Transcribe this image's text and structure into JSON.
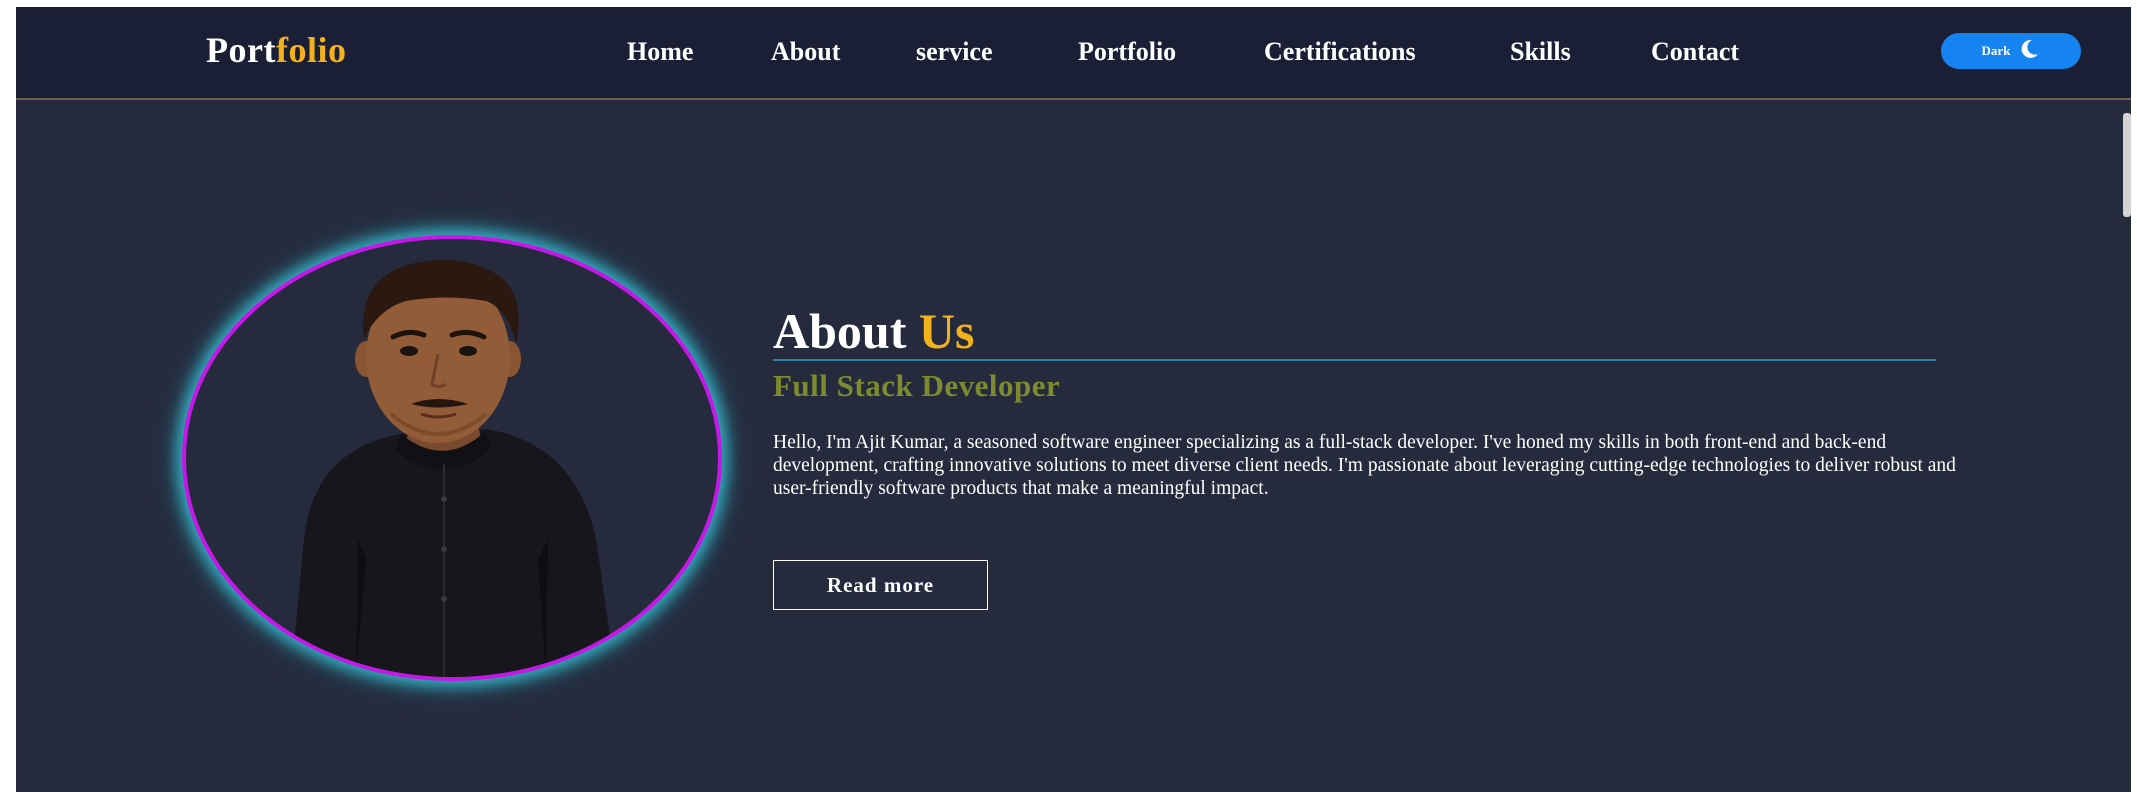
{
  "navbar": {
    "logo_part1": "Port",
    "logo_part2": "folio",
    "links": [
      {
        "label": "Home"
      },
      {
        "label": "About"
      },
      {
        "label": "service"
      },
      {
        "label": "Portfolio"
      },
      {
        "label": "Certifications"
      },
      {
        "label": "Skills"
      },
      {
        "label": "Contact"
      }
    ],
    "theme_toggle": {
      "label": "Dark",
      "icon": "moon-icon"
    }
  },
  "about": {
    "title_part1": "About",
    "title_part2": "Us",
    "subtitle": "Full Stack Developer",
    "bio": "Hello, I'm Ajit Kumar, a seasoned software engineer specializing as a full-stack developer. I've honed my skills in both front-end and back-end development, crafting innovative solutions to meet diverse client needs. I'm passionate about leveraging cutting-edge technologies to deliver robust and user-friendly software products that make a meaningful impact.",
    "button_label": "Read more",
    "photo_icon": "profile-photo"
  },
  "colors": {
    "background": "#262a3d",
    "navbar": "#1a1f36",
    "accent_yellow": "#f3b21b",
    "subtitle_olive": "#7d8a2f",
    "toggle_blue": "#1583f0",
    "ring_purple": "#c318e8",
    "ring_glow": "#39cfdf"
  }
}
